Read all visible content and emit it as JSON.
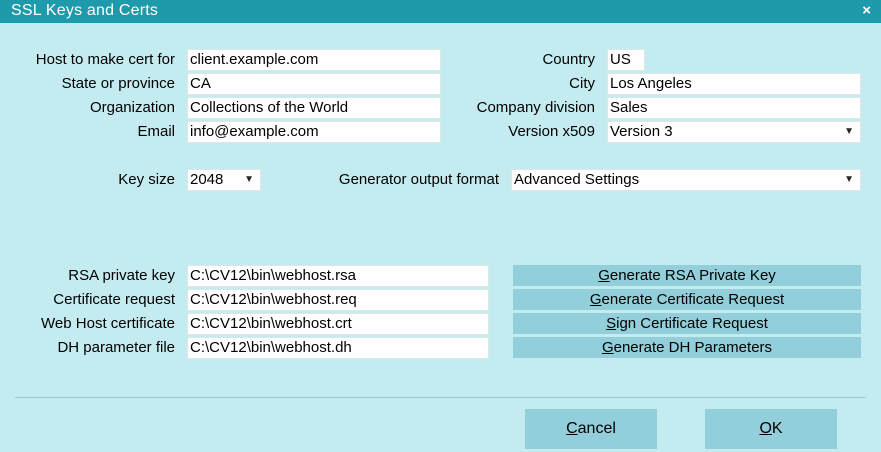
{
  "window": {
    "title": "SSL Keys and Certs",
    "close_glyph": "×",
    "close_icon": "close-icon"
  },
  "form": {
    "host": {
      "label": "Host to make cert for",
      "value": "client.example.com"
    },
    "state": {
      "label": "State or province",
      "value": "CA"
    },
    "org": {
      "label": "Organization",
      "value": "Collections of the World"
    },
    "email": {
      "label": "Email",
      "value": "info@example.com"
    },
    "country": {
      "label": "Country",
      "value": "US"
    },
    "city": {
      "label": "City",
      "value": "Los Angeles"
    },
    "division": {
      "label": "Company division",
      "value": "Sales"
    },
    "version": {
      "label": "Version x509",
      "value": "Version 3"
    },
    "keysize": {
      "label": "Key size",
      "value": "2048"
    },
    "genformat": {
      "label": "Generator output format",
      "value": "Advanced Settings"
    }
  },
  "files": {
    "rsa": {
      "label": "RSA private key",
      "value": "C:\\CV12\\bin\\webhost.rsa"
    },
    "req": {
      "label": "Certificate request",
      "value": "C:\\CV12\\bin\\webhost.req"
    },
    "crt": {
      "label": "Web Host certificate",
      "value": "C:\\CV12\\bin\\webhost.crt"
    },
    "dh": {
      "label": "DH parameter file",
      "value": "C:\\CV12\\bin\\webhost.dh"
    }
  },
  "actions": {
    "gen_rsa": {
      "mnemonic": "G",
      "rest": "enerate RSA Private Key"
    },
    "gen_req": {
      "mnemonic": "G",
      "rest": "enerate Certificate Request"
    },
    "sign_req": {
      "mnemonic": "S",
      "rest": "ign Certificate Request"
    },
    "gen_dh": {
      "mnemonic": "G",
      "rest": "enerate DH Parameters"
    }
  },
  "footer": {
    "cancel": {
      "mnemonic": "C",
      "rest": "ancel"
    },
    "ok": {
      "mnemonic": "O",
      "rest": "K"
    }
  },
  "dropdown_glyph": "▼",
  "dropdown_icon": "chevron-down-icon",
  "colors": {
    "titlebar": "#1f9aaa",
    "background": "#c4ebf0",
    "button": "#92cfdb"
  }
}
